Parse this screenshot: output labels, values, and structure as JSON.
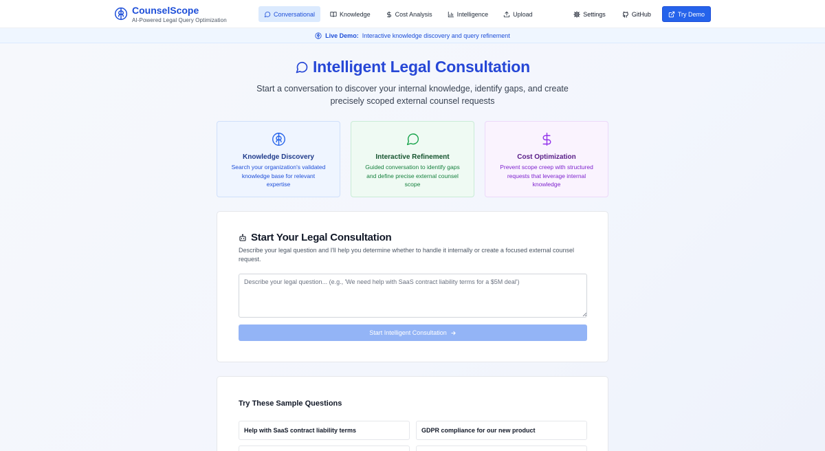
{
  "brand": {
    "name": "CounselScope",
    "tagline": "AI-Powered Legal Query Optimization"
  },
  "nav": {
    "items": [
      {
        "label": "Conversational",
        "icon": "message-circle-icon",
        "active": true
      },
      {
        "label": "Knowledge",
        "icon": "book-icon"
      },
      {
        "label": "Cost Analysis",
        "icon": "dollar-icon"
      },
      {
        "label": "Intelligence",
        "icon": "bar-chart-icon"
      },
      {
        "label": "Upload",
        "icon": "upload-icon"
      }
    ],
    "settings": "Settings",
    "github": "GitHub",
    "try_demo": "Try Demo"
  },
  "banner": {
    "strong": "Live Demo:",
    "text": "Interactive knowledge discovery and query refinement"
  },
  "hero": {
    "title": "Intelligent Legal Consultation",
    "subtitle": "Start a conversation to discover your internal knowledge, identify gaps, and create precisely scoped external counsel requests"
  },
  "features": [
    {
      "title": "Knowledge Discovery",
      "desc": "Search your organization's validated knowledge base for relevant expertise",
      "icon": "brain-icon",
      "color": "#2563eb"
    },
    {
      "title": "Interactive Refinement",
      "desc": "Guided conversation to identify gaps and define precise external counsel scope",
      "icon": "message-circle-icon",
      "color": "#16a34a"
    },
    {
      "title": "Cost Optimization",
      "desc": "Prevent scope creep with structured requests that leverage internal knowledge",
      "icon": "dollar-icon",
      "color": "#9333ea"
    }
  ],
  "consult": {
    "title": "Start Your Legal Consultation",
    "desc": "Describe your legal question and I'll help you determine whether to handle it internally or create a focused external counsel request.",
    "value": "",
    "placeholder": "Describe your legal question... (e.g., 'We need help with SaaS contract liability terms for a $5M deal')",
    "button": "Start Intelligent Consultation"
  },
  "samples": {
    "title": "Try These Sample Questions",
    "items": [
      "Help with SaaS contract liability terms",
      "GDPR compliance for our new product",
      "",
      ""
    ]
  },
  "colors": {
    "brand": "#1d4ed8",
    "primary": "#2563eb",
    "button_disabled": "#93b4f6"
  }
}
